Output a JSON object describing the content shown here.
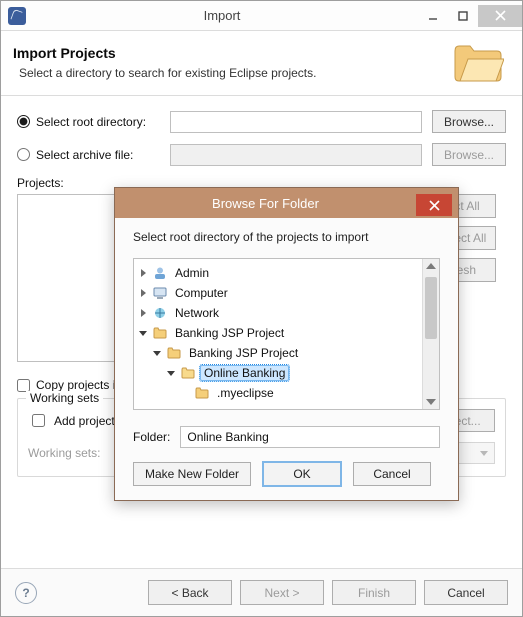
{
  "outer": {
    "title": "Import",
    "header_title": "Import Projects",
    "header_sub": "Select a directory to search for existing Eclipse projects.",
    "root_dir_label": "Select root directory:",
    "archive_label": "Select archive file:",
    "browse_label": "Browse...",
    "projects_label": "Projects:",
    "select_all": "Select All",
    "deselect_all": "Deselect All",
    "refresh": "Refresh",
    "copy_projects_label": "Copy projects into workspace",
    "working_sets_legend": "Working sets",
    "add_to_ws_label": "Add project to working sets",
    "ws_select_btn": "Select...",
    "ws_label": "Working sets:",
    "help_tooltip": "?",
    "back": "< Back",
    "next": "Next >",
    "finish": "Finish",
    "cancel": "Cancel"
  },
  "dialog": {
    "title": "Browse For Folder",
    "instruction": "Select root directory of the projects to import",
    "tree": {
      "admin": "Admin",
      "computer": "Computer",
      "network": "Network",
      "proj_root": "Banking JSP Project",
      "proj_sub": "Banking JSP Project",
      "selected": "Online Banking",
      "child": ".myeclipse"
    },
    "folder_label": "Folder:",
    "folder_value": "Online Banking",
    "make_new": "Make New Folder",
    "ok": "OK",
    "cancel": "Cancel"
  }
}
